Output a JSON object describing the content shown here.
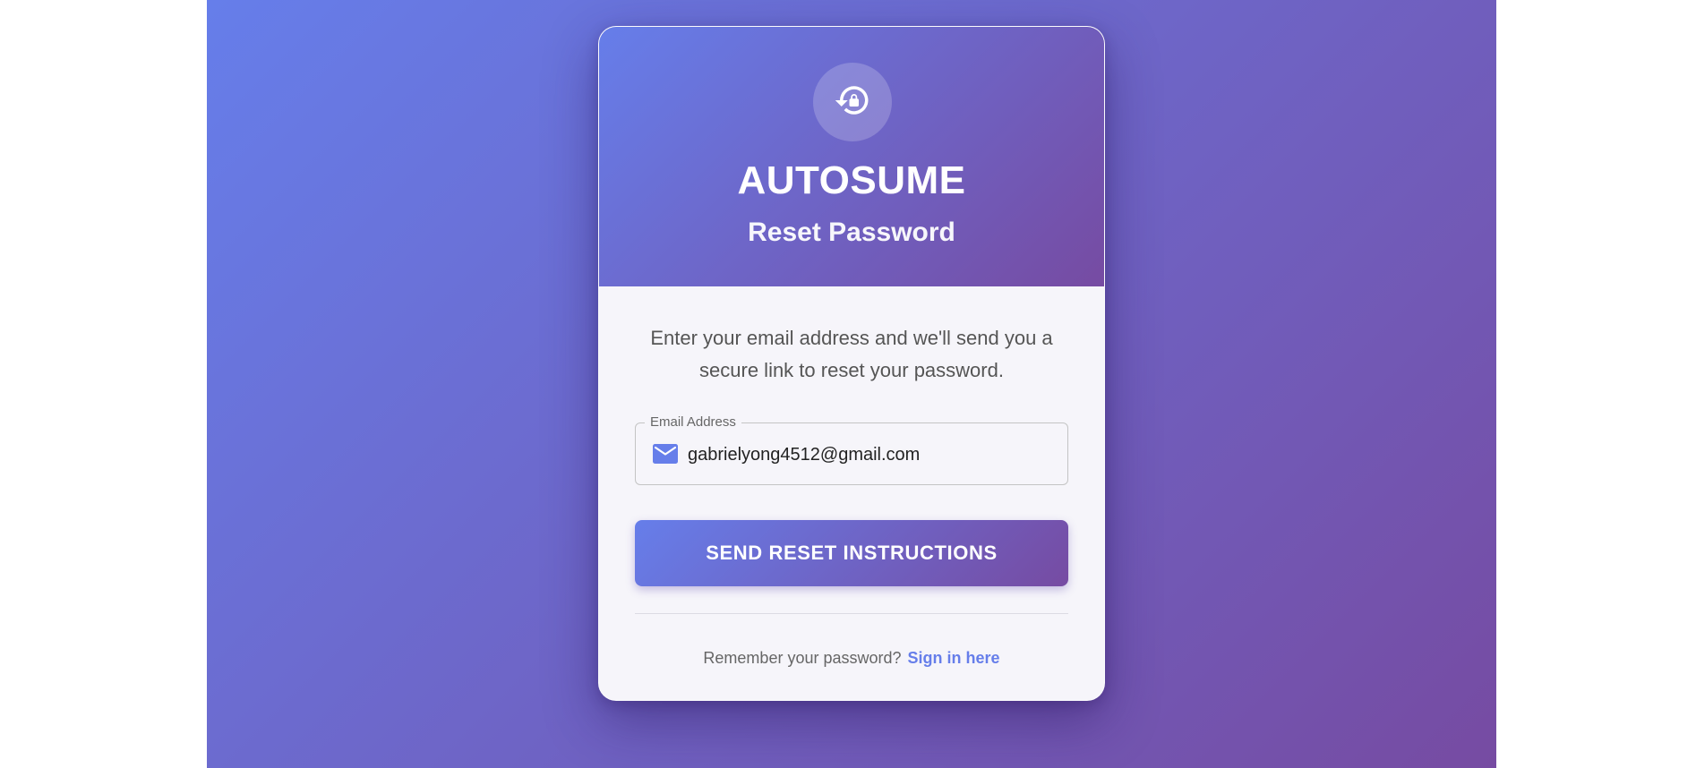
{
  "header": {
    "icon": "lock-reset-icon",
    "brand": "AUTOSUME",
    "subtitle": "Reset Password"
  },
  "body": {
    "description": "Enter your email address and we'll send you a secure link to reset your password.",
    "email_field": {
      "label": "Email Address",
      "icon": "mail-icon",
      "value": "gabrielyong4512@gmail.com"
    },
    "submit_label": "SEND RESET INSTRUCTIONS",
    "footer_text": "Remember your password?",
    "signin_link": "Sign in here"
  },
  "colors": {
    "gradient_start": "#667eea",
    "gradient_end": "#764ba2",
    "link": "#667eea",
    "card_bg": "#f6f5fa"
  }
}
